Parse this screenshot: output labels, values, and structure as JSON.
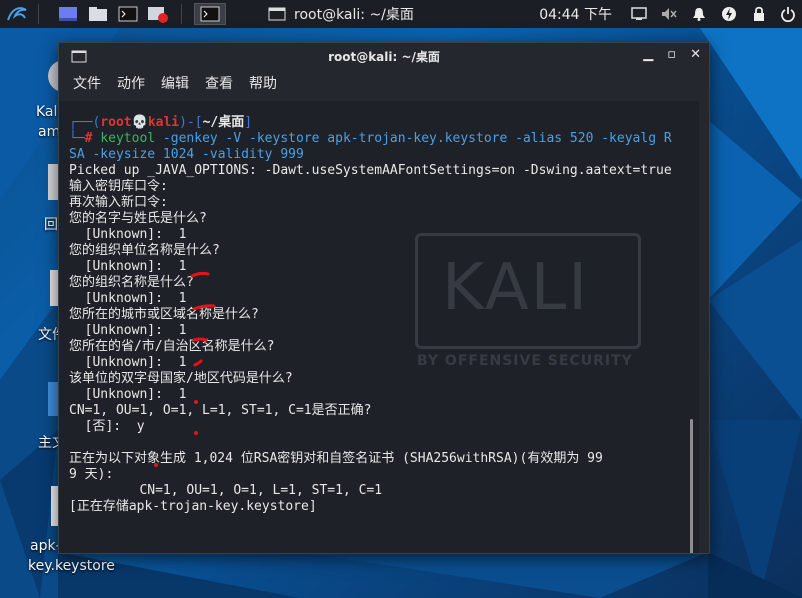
{
  "panel": {
    "task_title": "root@kali: ~/桌面",
    "clock": "04:44 下午"
  },
  "desktop": {
    "icons": [
      {
        "label": "Kali-Linux-...\name...",
        "name": "kali-icon"
      },
      {
        "label": "回收站",
        "name": "trash-icon"
      },
      {
        "label": "文件系统",
        "name": "filesystem-icon"
      },
      {
        "label": "主文件夹",
        "name": "home-folder-icon"
      },
      {
        "label": "apk-trojan-key.keystore",
        "name": "file-icon"
      }
    ],
    "partial_labels": [
      "Kali",
      "am",
      "回",
      "文件",
      "主文件夹",
      "apk-trojan-",
      "key.keystore"
    ]
  },
  "window": {
    "title": "root@kali: ~/桌面",
    "menu": [
      "文件",
      "动作",
      "编辑",
      "查看",
      "帮助"
    ]
  },
  "terminal": {
    "prompt_user": "root",
    "prompt_host": "kali",
    "prompt_dir": "~/桌面",
    "command_name": "keytool",
    "command_rest1": " -genkey -V -keystore apk-trojan-key.keystore -alias 520 -keyalg R",
    "command_rest2": "SA -keysize 1024 -validity 999",
    "lines": [
      "Picked up _JAVA_OPTIONS: -Dawt.useSystemAAFontSettings=on -Dswing.aatext=true",
      "输入密钥库口令:",
      "再次输入新口令:",
      "您的名字与姓氏是什么?",
      "  [Unknown]:  1",
      "您的组织单位名称是什么?",
      "  [Unknown]:  1",
      "您的组织名称是什么?",
      "  [Unknown]:  1",
      "您所在的城市或区域名称是什么?",
      "  [Unknown]:  1",
      "您所在的省/市/自治区名称是什么?",
      "  [Unknown]:  1",
      "该单位的双字母国家/地区代码是什么?",
      "  [Unknown]:  1",
      "CN=1, OU=1, O=1, L=1, ST=1, C=1是否正确?",
      "  [否]:  y",
      "",
      "正在为以下对象生成 1,024 位RSA密钥对和自签名证书 (SHA256withRSA)(有效期为 99",
      "9 天):",
      "         CN=1, OU=1, O=1, L=1, ST=1, C=1",
      "[正在存储apk-trojan-key.keystore]"
    ],
    "watermark_title": "KALI",
    "watermark_sub": "BY OFFENSIVE SECURITY"
  },
  "colors": {
    "terminal_bg": "#1e2127",
    "prompt_blue": "#3b7ad8",
    "prompt_red": "#e23434",
    "command_green": "#3fb35f",
    "option_blue": "#4aa0e6"
  }
}
